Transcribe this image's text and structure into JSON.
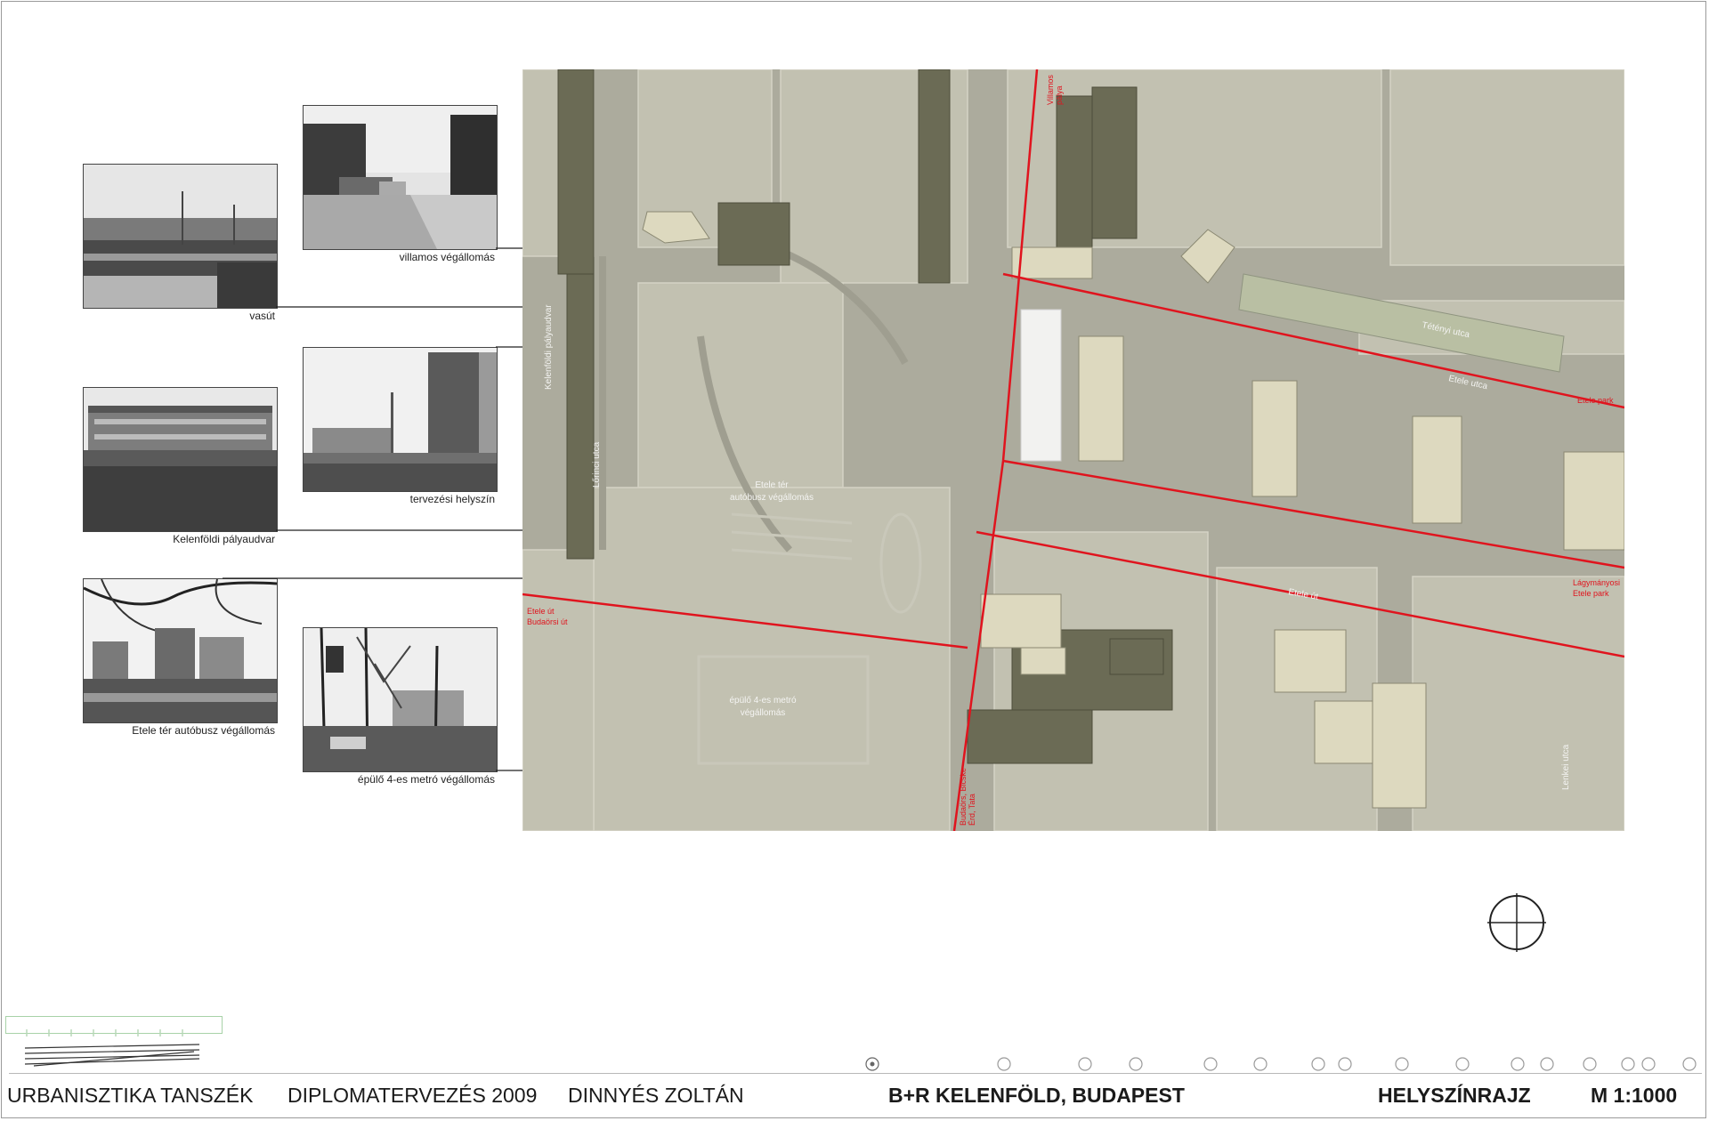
{
  "photos": [
    {
      "id": "vasut",
      "caption": "vasút"
    },
    {
      "id": "villamos",
      "caption": "villamos végállomás"
    },
    {
      "id": "kelenfoldi",
      "caption": "Kelenföldi pályaudvar"
    },
    {
      "id": "tervezesi",
      "caption": "tervezési helyszín"
    },
    {
      "id": "etele_busz",
      "caption": "Etele tér autóbusz végállomás"
    },
    {
      "id": "metro",
      "caption": "épülő 4-es metró végállomás"
    }
  ],
  "map": {
    "labels": {
      "palyaudvar": "Kelenföldi pályaudvar",
      "etele_ter": "Etele tér",
      "etele_ter_sub": "autóbusz végállomás",
      "metro_1": "épülő 4-es metró",
      "metro_2": "végállomás",
      "etele_ut": "Etele út",
      "tetenyi": "Tétényi utca",
      "etele_street": "Etele utca",
      "lentzi": "Lenkei utca",
      "lortelki": "Lőrinci utca",
      "red_top_1": "Villamos",
      "red_top_2": "pálya",
      "red_left_1": "Etele út",
      "red_left_2": "Budaörsi út",
      "red_bottom_1": "Budaörs, Bicske",
      "red_bottom_2": "Érd, Tata",
      "red_right_1": "Etele park",
      "red_right_2": "Lágymányosi",
      "red_right_3": "Etele park"
    },
    "colors": {
      "paper": "#c2c1b1",
      "road": "#acab9d",
      "dark_building": "#6b6b55",
      "light_building": "#ddd9bf",
      "red": "#e0141e"
    }
  },
  "footer": {
    "dept": "URBANISZTIKA TANSZÉK",
    "course": "DIPLOMATERVEZÉS 2009",
    "author": "DINNYÉS ZOLTÁN",
    "project": "B+R KELENFÖLD, BUDAPEST",
    "sheet": "HELYSZÍNRAJZ",
    "scale": "M 1:1000"
  },
  "icons": {
    "compass": "north-arrow-icon",
    "markers": "section-marker-icon"
  }
}
